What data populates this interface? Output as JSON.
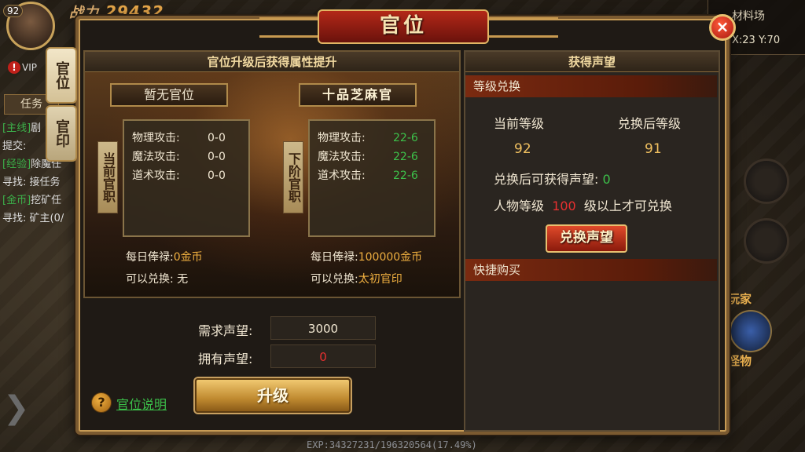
{
  "hud": {
    "level": "92",
    "power_label": "战力",
    "power_value": "29432",
    "vip": "VIP",
    "map_name": "材料场",
    "coords": "X:23 Y:70",
    "exp": "EXP:34327231/196320564(17.49%)",
    "monster_label_top": "玩家",
    "monster_label_bottom": "怪物"
  },
  "task_panel": {
    "tab": "任务",
    "lines": [
      {
        "tag": "[主线]",
        "text": "剧"
      },
      {
        "tag": "",
        "text": "提交:"
      },
      {
        "tag": "[经验]",
        "text": "除魔任"
      },
      {
        "tag": "",
        "text": "寻找: 接任务"
      },
      {
        "tag": "[金币]",
        "text": "挖矿任"
      },
      {
        "tag": "",
        "text": "寻找: 矿主(0/"
      }
    ]
  },
  "side_tabs": {
    "rank": "官位",
    "seal": "官印"
  },
  "dialog": {
    "title": "官位",
    "close": "×",
    "left": {
      "header": "官位升级后获得属性提升",
      "current_rank": "暂无官位",
      "next_rank": "十品芝麻官",
      "current_label": "当前官职",
      "next_label": "下阶官职",
      "current_stats": [
        {
          "k": "物理攻击:",
          "v": "0-0"
        },
        {
          "k": "魔法攻击:",
          "v": "0-0"
        },
        {
          "k": "道术攻击:",
          "v": "0-0"
        }
      ],
      "next_stats": [
        {
          "k": "物理攻击:",
          "v": "22-6"
        },
        {
          "k": "魔法攻击:",
          "v": "22-6"
        },
        {
          "k": "道术攻击:",
          "v": "22-6"
        }
      ],
      "salary_label": "每日俸禄:",
      "current_salary": "0金币",
      "next_salary": "100000金币",
      "exchange_label": "可以兑换:",
      "current_exchange": "无",
      "next_exchange": "太初官印"
    },
    "requirements": {
      "need_label": "需求声望:",
      "need_value": "3000",
      "have_label": "拥有声望:",
      "have_value": "0"
    },
    "help_link": "官位说明",
    "upgrade_button": "升级",
    "right": {
      "header": "获得声望",
      "level_exchange": "等级兑换",
      "current_level_label": "当前等级",
      "after_level_label": "兑换后等级",
      "current_level": "92",
      "after_level": "91",
      "gain_label": "兑换后可获得声望:",
      "gain_value": "0",
      "req_pre": "人物等级",
      "req_level": "100",
      "req_post": "级以上才可兑换",
      "exchange_button": "兑换声望",
      "quick_buy": "快捷购买"
    }
  }
}
